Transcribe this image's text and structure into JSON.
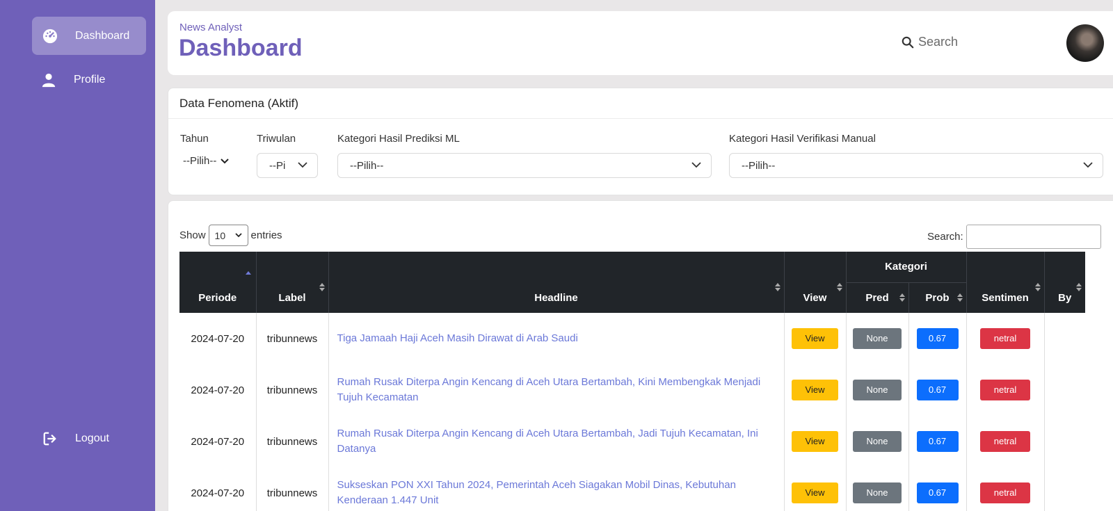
{
  "sidebar": {
    "items": [
      {
        "label": "Dashboard",
        "icon": "gauge-icon",
        "active": true
      },
      {
        "label": "Profile",
        "icon": "user-icon",
        "active": false
      }
    ],
    "logout": {
      "label": "Logout",
      "icon": "logout-icon"
    }
  },
  "header": {
    "subtitle": "News Analyst",
    "title": "Dashboard",
    "search_placeholder": "Search"
  },
  "filters": {
    "title": "Data Fenomena (Aktif)",
    "tahun": {
      "label": "Tahun",
      "value": "--Pilih--"
    },
    "triwulan": {
      "label": "Triwulan",
      "value": "--Pi"
    },
    "prediksi": {
      "label": "Kategori Hasil Prediksi ML",
      "value": "--Pilih--"
    },
    "verifikasi": {
      "label": "Kategori Hasil Verifikasi Manual",
      "value": "--Pilih--"
    }
  },
  "table": {
    "show_label": "Show",
    "entries_label": "entries",
    "page_length": "10",
    "search_label": "Search:",
    "group_header": "Kategori",
    "columns": {
      "periode": "Periode",
      "label": "Label",
      "headline": "Headline",
      "view": "View",
      "pred": "Pred",
      "prob": "Prob",
      "sentimen": "Sentimen",
      "by": "By"
    },
    "rows": [
      {
        "periode": "2024-07-20",
        "label": "tribunnews",
        "headline": "Tiga Jamaah Haji Aceh Masih Dirawat di Arab Saudi",
        "view": "View",
        "pred": "None",
        "prob": "0.67",
        "sentimen": "netral",
        "by": ""
      },
      {
        "periode": "2024-07-20",
        "label": "tribunnews",
        "headline": "Rumah Rusak Diterpa Angin Kencang di Aceh Utara Bertambah, Kini Membengkak Menjadi Tujuh Kecamatan",
        "view": "View",
        "pred": "None",
        "prob": "0.67",
        "sentimen": "netral",
        "by": ""
      },
      {
        "periode": "2024-07-20",
        "label": "tribunnews",
        "headline": "Rumah Rusak Diterpa Angin Kencang di Aceh Utara Bertambah, Jadi Tujuh Kecamatan, Ini Datanya",
        "view": "View",
        "pred": "None",
        "prob": "0.67",
        "sentimen": "netral",
        "by": ""
      },
      {
        "periode": "2024-07-20",
        "label": "tribunnews",
        "headline": "Sukseskan PON XXI Tahun 2024, Pemerintah Aceh Siagakan Mobil Dinas, Kebutuhan Kenderaan 1.447 Unit",
        "view": "View",
        "pred": "None",
        "prob": "0.67",
        "sentimen": "netral",
        "by": ""
      }
    ]
  },
  "colors": {
    "brand": "#6f60b9",
    "view": "#fec107",
    "pred": "#6c757d",
    "prob": "#0c6efd",
    "sentimen": "#dc3545",
    "table_head": "#212529"
  }
}
